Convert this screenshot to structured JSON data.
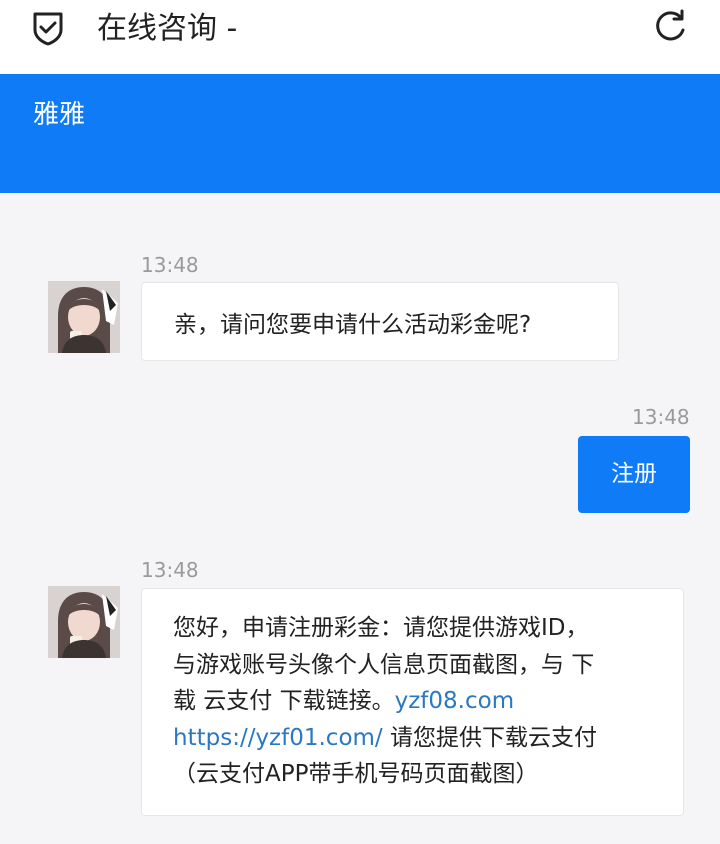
{
  "topbar": {
    "title": "在线咨询 -",
    "left_icon": "shield-check-icon",
    "right_icon": "refresh-icon"
  },
  "header": {
    "agent_name": "雅雅",
    "background": "#0f7bf7"
  },
  "messages": [
    {
      "side": "left",
      "time": "13:48",
      "avatar": "agent-avatar",
      "text": "亲，请问您要申请什么活动彩金呢?"
    },
    {
      "side": "right",
      "time": "13:48",
      "text": "注册"
    },
    {
      "side": "left",
      "time": "13:48",
      "avatar": "agent-avatar",
      "line1": "您好，申请注册彩金：请您提供游戏ID，",
      "line2": "与游戏账号头像个人信息页面截图，与 下",
      "line3_text": "载 云支付 下载链接。",
      "line3_link": "yzf08.com",
      "line4_link": "https://yzf01.com/",
      "line4_text": " 请您提供下载云支付",
      "line5": "（云支付APP带手机号码页面截图）"
    }
  ]
}
